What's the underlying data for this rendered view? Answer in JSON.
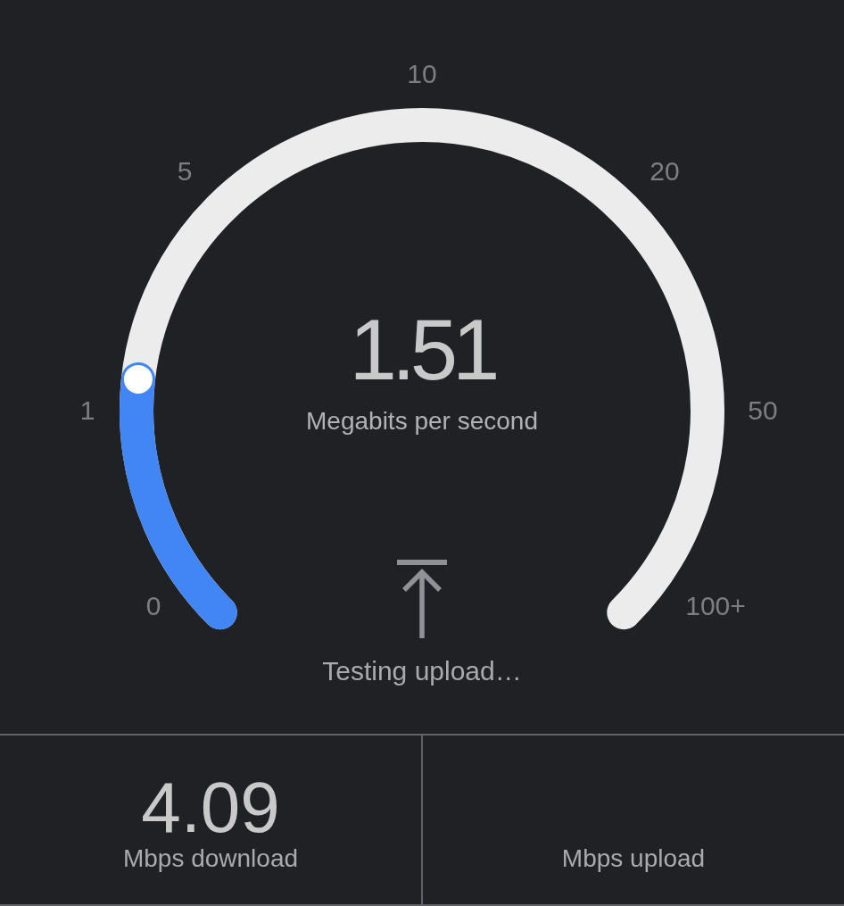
{
  "gauge": {
    "ticks": [
      "0",
      "1",
      "5",
      "10",
      "20",
      "50",
      "100+"
    ],
    "level": 0.19,
    "value": "1.51",
    "unit": "Megabits per second"
  },
  "status": {
    "kind": "upload",
    "text": "Testing upload…"
  },
  "results": [
    {
      "value": "4.09",
      "label": "Mbps download"
    },
    {
      "label": "Mbps upload"
    }
  ]
}
